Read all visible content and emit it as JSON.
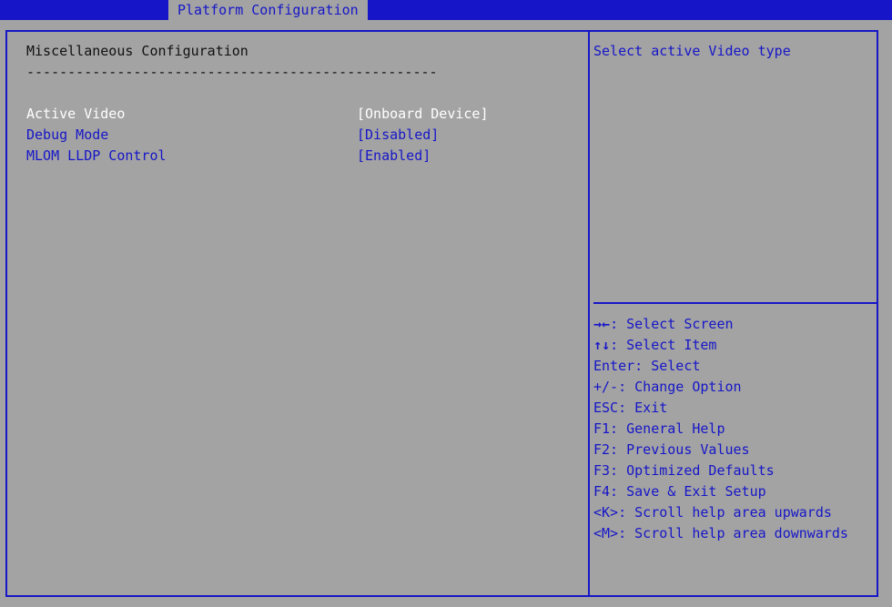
{
  "header": {
    "active_tab": "Platform Configuration"
  },
  "main": {
    "section_title": "Miscellaneous Configuration",
    "separator": "--------------------------------------------------",
    "settings": [
      {
        "label": "Active Video",
        "value": "[Onboard Device]",
        "selected": true
      },
      {
        "label": "Debug Mode",
        "value": "[Disabled]",
        "selected": false
      },
      {
        "label": "MLOM LLDP Control",
        "value": "[Enabled]",
        "selected": false
      }
    ]
  },
  "help": {
    "text": "Select active Video type"
  },
  "legend": [
    {
      "key": "→←",
      "desc": ": Select Screen"
    },
    {
      "key": "↑↓",
      "desc": ": Select Item"
    },
    {
      "key": "",
      "desc": "Enter: Select"
    },
    {
      "key": "",
      "desc": "+/-: Change Option"
    },
    {
      "key": "",
      "desc": "ESC: Exit"
    },
    {
      "key": "",
      "desc": "F1: General Help"
    },
    {
      "key": "",
      "desc": "F2: Previous Values"
    },
    {
      "key": "",
      "desc": "F3: Optimized Defaults"
    },
    {
      "key": "",
      "desc": "F4: Save & Exit Setup"
    },
    {
      "key": "",
      "desc": "<K>: Scroll help area upwards"
    },
    {
      "key": "",
      "desc": "<M>: Scroll help area downwards"
    }
  ]
}
